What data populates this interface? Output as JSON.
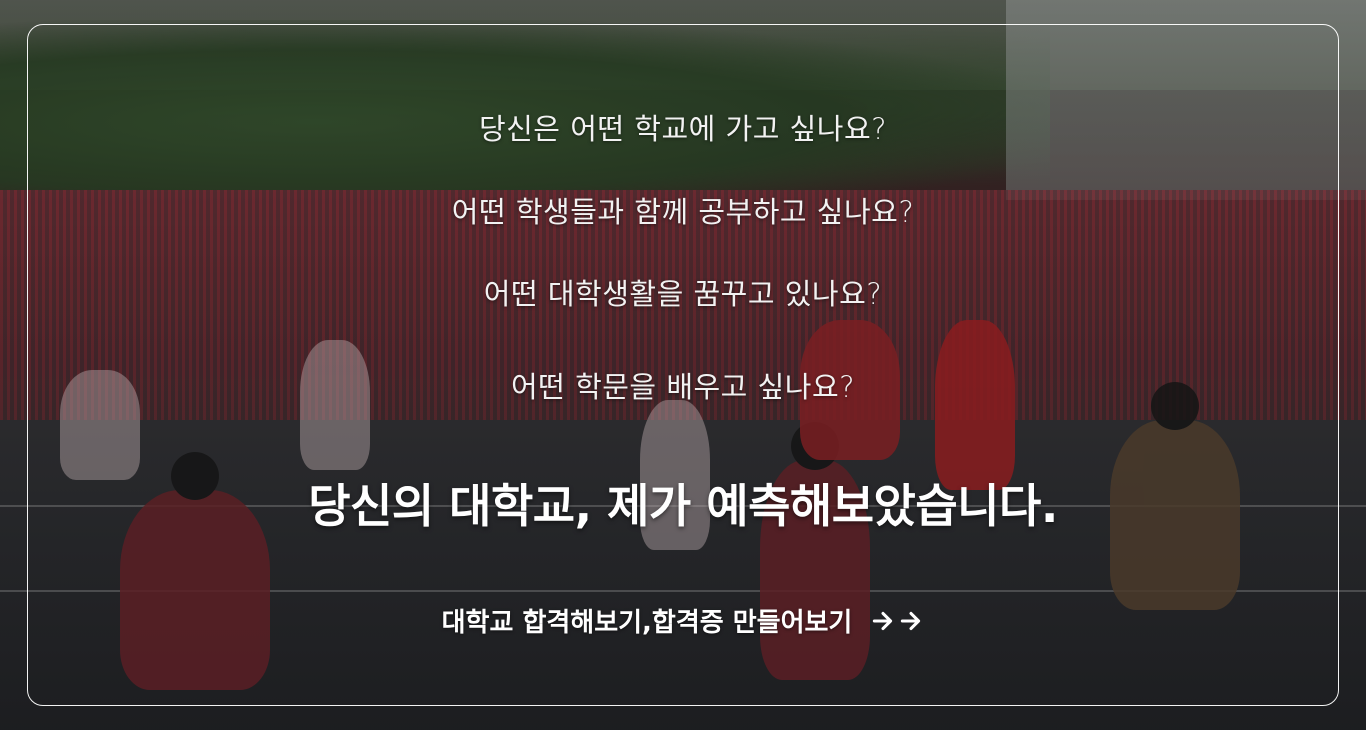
{
  "hero": {
    "questions": [
      "당신은 어떤 학교에 가고 싶나요?",
      "어떤 학생들과 함께 공부하고 싶나요?",
      "어떤 대학생활을 꿈꾸고 있나요?",
      "어떤 학문을 배우고 싶나요?"
    ],
    "headline": "당신의 대학교, 제가 예측해보았습니다.",
    "cta_label": "대학교 합격해보기,합격증 만들어보기",
    "cta_icons": [
      "arrow-right-icon",
      "arrow-right-icon"
    ]
  },
  "colors": {
    "text": "#ffffff",
    "frame_border": "#ffffff"
  }
}
